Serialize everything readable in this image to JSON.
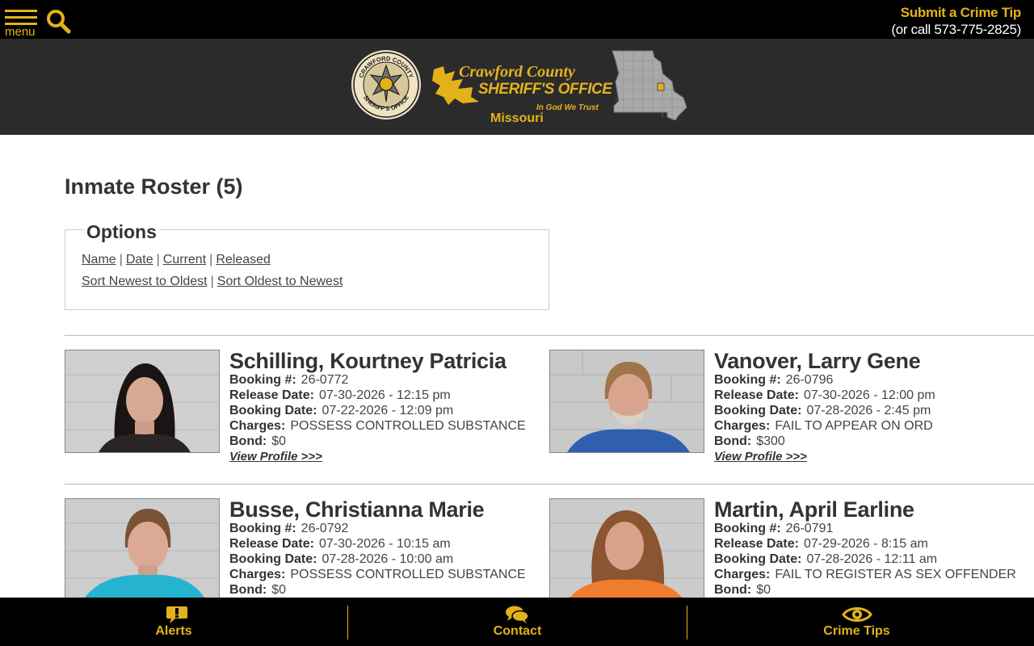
{
  "topbar": {
    "menu_label": "menu",
    "crime_tip_title": "Submit a Crime Tip",
    "crime_tip_phone": "(or call 573-775-2825)"
  },
  "banner": {
    "seal_text_top": "CRAWFORD COUNTY",
    "seal_text_bottom": "SHERIFF'S OFFICE",
    "county": "Crawford County",
    "office": "SHERIFF'S OFFICE",
    "motto": "In God We Trust",
    "state": "Missouri"
  },
  "page": {
    "title": "Inmate Roster (5)"
  },
  "options": {
    "legend": "Options",
    "filters": [
      "Name",
      "Date",
      "Current",
      "Released"
    ],
    "sort": [
      "Sort Newest to Oldest",
      "Sort Oldest to Newest"
    ]
  },
  "labels": {
    "booking": "Booking #:",
    "release": "Release Date:",
    "booking_date": "Booking Date:",
    "charges": "Charges:",
    "bond": "Bond:",
    "view_profile": "View Profile >>>"
  },
  "inmates": [
    {
      "name": "Schilling, Kourtney Patricia",
      "booking": "26-0772",
      "release": "07-30-2026 - 12:15 pm",
      "booking_date": "07-22-2026 - 12:09 pm",
      "charges": "POSSESS CONTROLLED SUBSTANCE",
      "bond": "$0"
    },
    {
      "name": "Vanover, Larry Gene",
      "booking": "26-0796",
      "release": "07-30-2026 - 12:00 pm",
      "booking_date": "07-28-2026 - 2:45 pm",
      "charges": "FAIL TO APPEAR ON ORD",
      "bond": "$300"
    },
    {
      "name": "Busse, Christianna Marie",
      "booking": "26-0792",
      "release": "07-30-2026 - 10:15 am",
      "booking_date": "07-28-2026 - 10:00 am",
      "charges": "POSSESS CONTROLLED SUBSTANCE",
      "bond": "$0"
    },
    {
      "name": "Martin, April Earline",
      "booking": "26-0791",
      "release": "07-29-2026 - 8:15 am",
      "booking_date": "07-28-2026 - 12:11 am",
      "charges": "FAIL TO REGISTER AS SEX OFFENDER",
      "bond": "$0"
    }
  ],
  "bottom_nav": {
    "alerts": "Alerts",
    "contact": "Contact",
    "crime_tips": "Crime Tips"
  },
  "colors": {
    "accent": "#e3b21b",
    "banner_bg": "#2b2b2b",
    "topbar_bg": "#000000"
  }
}
